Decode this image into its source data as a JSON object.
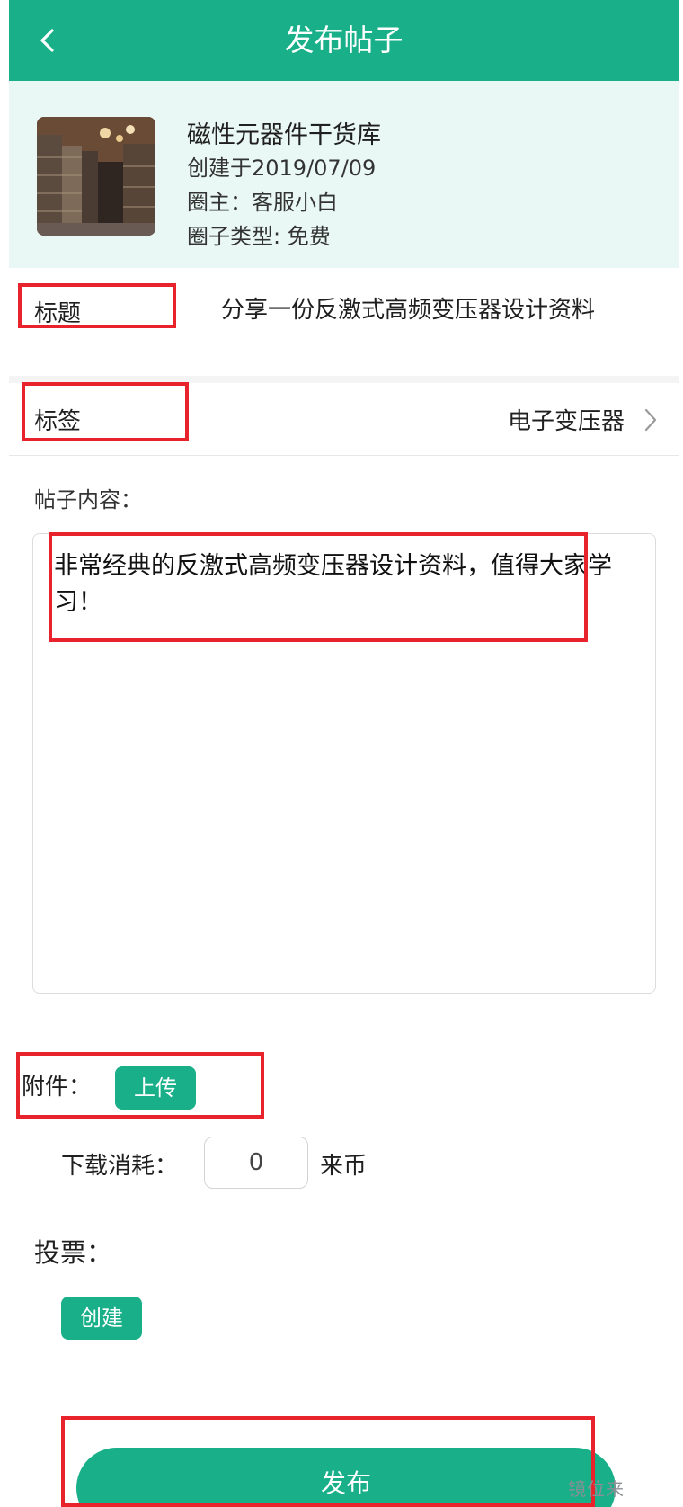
{
  "header": {
    "title": "发布帖子",
    "back_icon": "chevron-left-icon"
  },
  "circle": {
    "name": "磁性元器件干货库",
    "created": "创建于2019/07/09",
    "owner": "圈主：客服小白",
    "type": "圈子类型: 免费"
  },
  "form": {
    "title_label": "标题",
    "title_value": "分享一份反激式高频变压器设计资料",
    "tag_label": "标签",
    "tag_value": "电子变压器",
    "content_label": "帖子内容：",
    "content_value": "非常经典的反激式高频变压器设计资料，值得大家学习！",
    "attachment_label": "附件：",
    "upload_button": "上传",
    "download_cost_label": "下载消耗：",
    "download_cost_value": "0",
    "download_cost_unit": "来币",
    "vote_label": "投票：",
    "create_button": "创建"
  },
  "publish_button": "发布",
  "watermark": "镜位来",
  "colors": {
    "accent": "#19b089",
    "annotation_red": "#e8232b"
  }
}
